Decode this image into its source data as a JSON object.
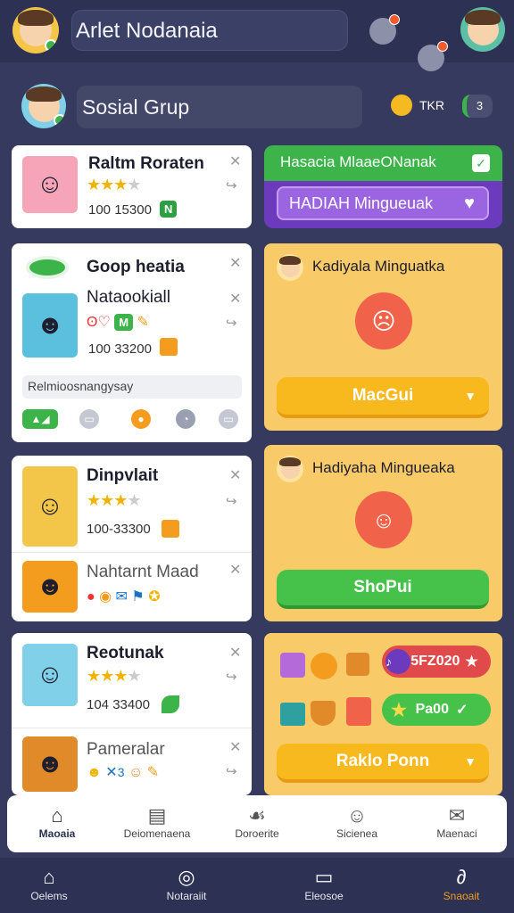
{
  "header": {
    "title": "Arlet Nodanaia",
    "notif_icon_1": "bell-icon",
    "notif_icon_2": "bell-icon"
  },
  "group": {
    "title": "Sosial Grup",
    "coin_label": "TKR",
    "chat_count": "3"
  },
  "cards_left": [
    {
      "title": "Raltm Roraten",
      "rating": 3,
      "meta": "100 15300",
      "badge": "N"
    },
    {
      "title": "Goop heatia",
      "subtitle": "Nataookiall",
      "meta": "100 33200",
      "input": "Relmioosnangysay"
    },
    {
      "title": "Dinpvlait",
      "rating": 3,
      "meta": "100-33300",
      "subtitle": "Nahtarnt Maad"
    },
    {
      "title": "Reotunak",
      "rating": 3,
      "meta": "104 33400",
      "subtitle": "Pameralar"
    }
  ],
  "right_panels": {
    "banner_top": "Hasacia MlaaeONanak",
    "banner_bottom": "HADIAH Mingueuak",
    "panel1_title": "Kadiyala Minguatka",
    "panel1_button": "MacGui",
    "panel2_title": "Hadiyaha Mingueaka",
    "panel2_button": "ShoPui",
    "pill1": "5FZ020",
    "pill2": "Pa00",
    "panel3_button": "Raklo Ponn"
  },
  "bottom_tabs": [
    "Maoaia",
    "Deiomenaena",
    "Doroerite",
    "Sicienea",
    "Maenaci"
  ],
  "nav_tabs": [
    "Oelems",
    "Notaraiit",
    "Eleosoe",
    "Snaoait"
  ],
  "colors": {
    "bg": "#363a5e",
    "accent_green": "#3cb44a",
    "accent_purple": "#6c3bbd",
    "accent_yellow": "#f9cb68",
    "accent_orange": "#f39c1d"
  }
}
